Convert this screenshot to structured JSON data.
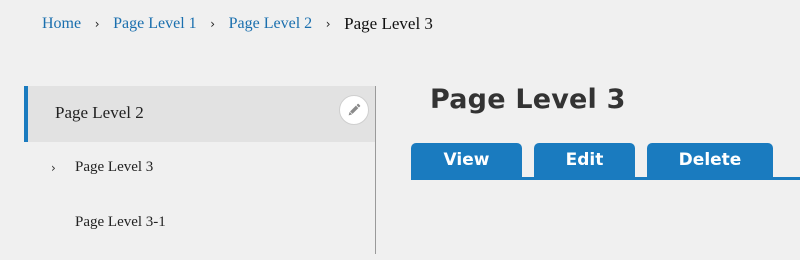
{
  "breadcrumb": {
    "items": [
      {
        "label": "Home"
      },
      {
        "label": "Page Level 1"
      },
      {
        "label": "Page Level 2"
      }
    ],
    "current": "Page Level 3",
    "separator": "›"
  },
  "sidebar": {
    "active": {
      "label": "Page Level 2",
      "edit_icon": "pencil-icon"
    },
    "items": [
      {
        "label": "Page Level 3",
        "icon": "chevron-right-icon",
        "chevron": "›"
      },
      {
        "label": "Page Level 3-1"
      }
    ]
  },
  "main": {
    "title": "Page Level 3",
    "tabs": [
      {
        "label": "View"
      },
      {
        "label": "Edit"
      },
      {
        "label": "Delete"
      }
    ]
  },
  "colors": {
    "accent": "#1a7bbf",
    "link": "#1a6fae",
    "background": "#f0f0f0",
    "sidebar_active_bg": "#e2e2e2"
  }
}
